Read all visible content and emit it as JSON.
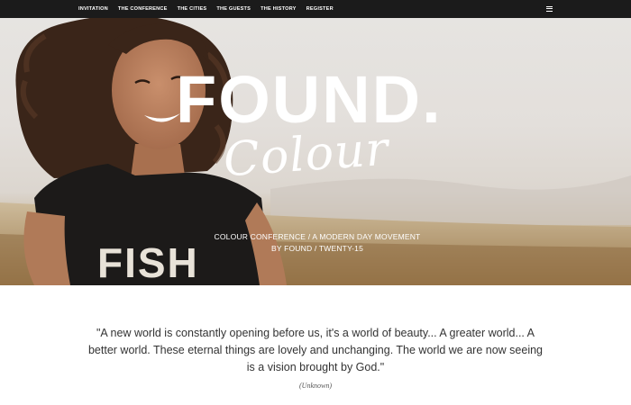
{
  "nav": {
    "links": [
      "INVITATION",
      "THE CONFERENCE",
      "THE CITIES",
      "THE GUESTS",
      "THE HISTORY",
      "REGISTER"
    ],
    "menu_icon": "hamburger-menu-icon"
  },
  "hero": {
    "title": "FOUND.",
    "script": "Colour",
    "subtitle_line1": "COLOUR CONFERENCE / A MODERN DAY MOVEMENT",
    "subtitle_line2": "BY FOUND / TWENTY-15",
    "shirt_text": "FISH"
  },
  "quote": {
    "text": "\"A new world is constantly opening before us, it's a world of beauty... A greater world... A better world. These eternal things are lovely and unchanging. The world we are now seeing is a vision brought by God.\"",
    "author": "(Unknown)"
  }
}
